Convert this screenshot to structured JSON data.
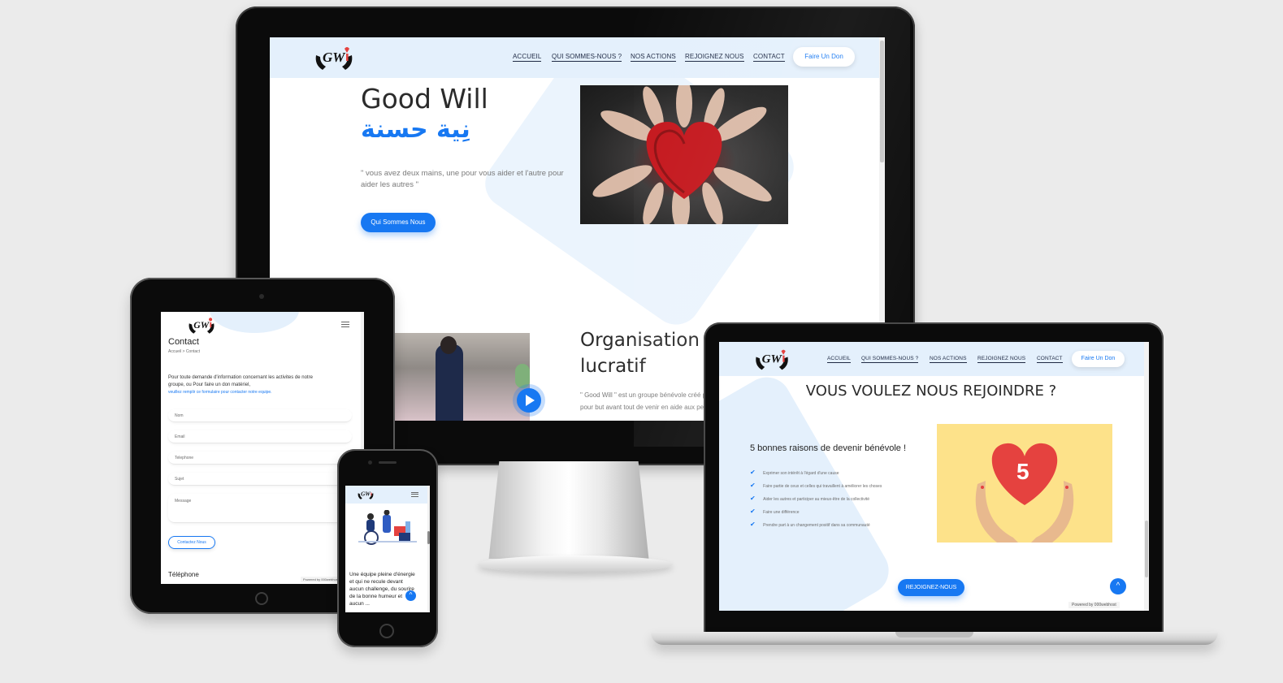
{
  "desktop": {
    "nav": {
      "items": [
        {
          "label": "ACCUEIL"
        },
        {
          "label": "QUI SOMMES-NOUS ?"
        },
        {
          "label": "NOS ACTIONS"
        },
        {
          "label": "REJOIGNEZ NOUS"
        },
        {
          "label": "CONTACT"
        }
      ],
      "donate_label": "Faire Un Don"
    },
    "hero": {
      "title": "Good Will",
      "arabic_title": "نِية حسنة",
      "quote": "\" vous avez deux mains, une pour vous aider et l'autre pour aider les autres \"",
      "button_label": "Qui Sommes Nous"
    },
    "section2": {
      "title_line1": "Organisation à",
      "title_line2": "lucratif",
      "text": "\" Good Will \" est un groupe bénévole créé par",
      "text2": "pour but avant tout de venir en aide aux perso"
    }
  },
  "tablet": {
    "title": "Contact",
    "breadcrumb": "Accueil > Contact",
    "intro_line1": "Pour toute demande d'information concernant les activites de notre",
    "intro_line2": "groupe, ou Pour faire un don matériel,",
    "intro_line3": "veuillez remplir ce formulaire pour contacter notre equipe.",
    "fields": [
      {
        "placeholder": "Nom"
      },
      {
        "placeholder": "Email"
      },
      {
        "placeholder": "Telephone"
      },
      {
        "placeholder": "Sujet"
      },
      {
        "placeholder": "Message"
      }
    ],
    "submit_label": "Contactez Nous",
    "footer_heading": "Téléphone",
    "powered_by": "Powered by 000webhost"
  },
  "phone": {
    "text_line1": "Une équipe pleine d'énergie",
    "text_line2": "et qui ne recule devant",
    "text_line3": "aucun challenge, du sourire",
    "text_line4": "de la bonne humeur et",
    "text_line5": "aucun ..."
  },
  "laptop": {
    "nav": {
      "items": [
        {
          "label": "ACCUEIL"
        },
        {
          "label": "QUI SOMMES-NOUS ?"
        },
        {
          "label": "NOS ACTIONS"
        },
        {
          "label": "REJOIGNEZ NOUS"
        },
        {
          "label": "CONTACT"
        }
      ],
      "donate_label": "Faire Un Don"
    },
    "heading": "VOUS VOULEZ NOUS REJOINDRE ?",
    "reasons_title": "5 bonnes raisons de devenir bénévole !",
    "reasons": [
      "Exprimer son intérêt à l'égard d'une cause",
      "Faire partie de ceux et celles qui travaillent à améliorer les choses",
      "Aider les autres et participer au mieux-être de la collectivité",
      "Faire une différence",
      "Prendre part à un changement positif dans sa communauté"
    ],
    "heart_number": "5",
    "button_label": "REJOIGNEZ-NOUS",
    "powered_by": "Powered by 000webhost"
  },
  "colors": {
    "accent": "#1778f2",
    "header_bg": "#e4f0fc",
    "heart": "#e5423f",
    "heart_bg": "#fde28a"
  },
  "icons": [
    "good-will-logo",
    "hamburger-menu-icon",
    "play-icon",
    "scroll-top-icon",
    "check-icon"
  ]
}
